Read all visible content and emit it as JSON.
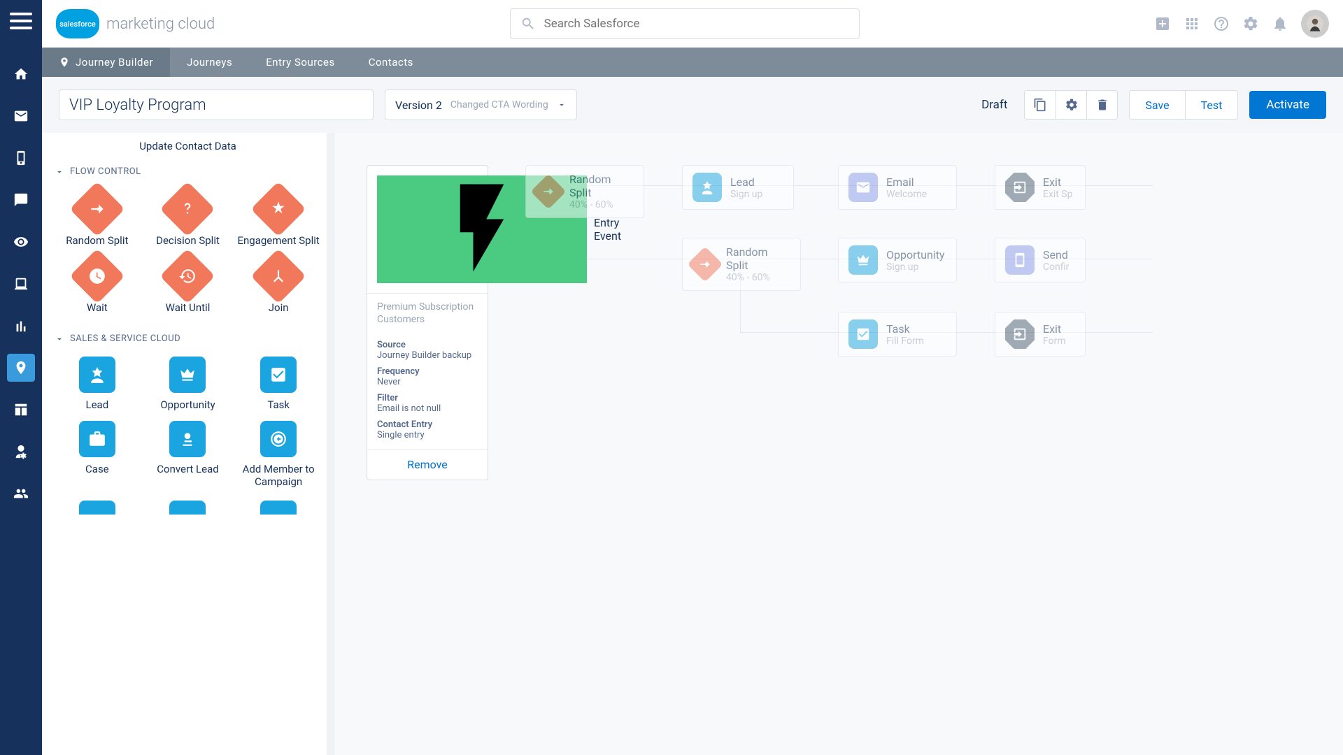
{
  "brand": {
    "logo_text": "salesforce",
    "name": "marketing cloud"
  },
  "search": {
    "placeholder": "Search Salesforce"
  },
  "subnav": {
    "items": [
      {
        "label": "Journey Builder",
        "active": true,
        "has_icon": true
      },
      {
        "label": "Journeys"
      },
      {
        "label": "Entry Sources"
      },
      {
        "label": "Contacts"
      }
    ]
  },
  "toolbar": {
    "title": "VIP Loyalty Program",
    "version_label": "Version 2",
    "version_note": "Changed CTA Wording",
    "status": "Draft",
    "save": "Save",
    "test": "Test",
    "activate": "Activate"
  },
  "palette": {
    "top_item": "Update Contact Data",
    "sections": [
      {
        "name": "FLOW CONTROL",
        "items": [
          {
            "label": "Random Split",
            "shape": "diamond",
            "icon": "split"
          },
          {
            "label": "Decision Split",
            "shape": "diamond",
            "icon": "question"
          },
          {
            "label": "Engagement Split",
            "shape": "diamond",
            "icon": "spark"
          },
          {
            "label": "Wait",
            "shape": "diamond",
            "icon": "clock"
          },
          {
            "label": "Wait Until",
            "shape": "diamond",
            "icon": "clock-arrow"
          },
          {
            "label": "Join",
            "shape": "diamond",
            "icon": "merge"
          }
        ]
      },
      {
        "name": "SALES & SERVICE CLOUD",
        "items": [
          {
            "label": "Lead",
            "shape": "sq-blue",
            "icon": "star-person"
          },
          {
            "label": "Opportunity",
            "shape": "sq-blue",
            "icon": "crown"
          },
          {
            "label": "Task",
            "shape": "sq-blue",
            "icon": "check"
          },
          {
            "label": "Case",
            "shape": "sq-blue",
            "icon": "briefcase"
          },
          {
            "label": "Convert Lead",
            "shape": "sq-blue",
            "icon": "convert"
          },
          {
            "label": "Add Member to Campaign",
            "shape": "sq-blue",
            "icon": "target"
          }
        ]
      }
    ]
  },
  "entry_card": {
    "title": "Entry Event",
    "subtitle": "Premium Subscription Customers",
    "rows": [
      {
        "label": "Source",
        "value": "Journey Builder backup"
      },
      {
        "label": "Frequency",
        "value": "Never"
      },
      {
        "label": "Filter",
        "value": "Email is not null"
      },
      {
        "label": "Contact Entry",
        "value": "Single entry"
      }
    ],
    "remove": "Remove"
  },
  "flow_nodes": {
    "split1": {
      "title": "Random Split",
      "sub": "40% - 60%"
    },
    "lead": {
      "title": "Lead",
      "sub": "Sign up"
    },
    "email": {
      "title": "Email",
      "sub": "Welcome"
    },
    "exit1": {
      "title": "Exit",
      "sub": "Exit Sp"
    },
    "split2": {
      "title": "Random Split",
      "sub": "40% - 60%"
    },
    "opp": {
      "title": "Opportunity",
      "sub": "Sign up"
    },
    "send": {
      "title": "Send",
      "sub": "Confir"
    },
    "task": {
      "title": "Task",
      "sub": "Fill Form"
    },
    "exit2": {
      "title": "Exit",
      "sub": "Form"
    }
  },
  "colors": {
    "orange": "#f2785b",
    "blue": "#1ba5e0",
    "green": "#4bca81",
    "periwinkle": "#8a9be8",
    "slate": "#4a5e6f"
  }
}
